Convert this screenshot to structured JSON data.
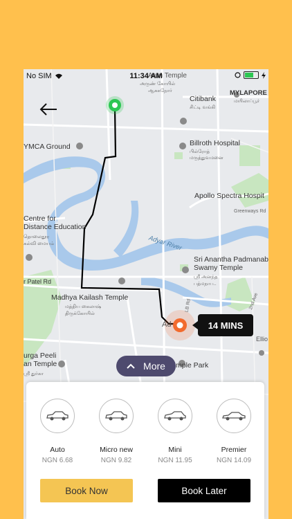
{
  "status_bar": {
    "carrier": "No SIM",
    "time": "11:34 AM"
  },
  "map_labels": {
    "temple_top": "Arun Temple",
    "temple_top_ta": "அருண் கோயில்",
    "temple_top_ta2": "ஆசுசுநோர்",
    "mylapore": "MYLAPORE",
    "mylapore_ta": "மயிலாப்பூர்",
    "citibank": "Citibank",
    "citibank_ta": "சிட்டி வங்கி",
    "billroth": "Billroth Hospital",
    "billroth_ta": "பில்ரோத்",
    "billroth_ta2": "மருத்துவமனை",
    "ymca": "YMCA Ground",
    "apollo": "Apollo Spectra Hospit",
    "greenways": "Greenways Rd",
    "centre_1": "Centre for",
    "centre_2": "Distance Education",
    "centre_ta1": "தொலைதூர",
    "centre_ta2": "கல்வி மையம்",
    "adyar_river": "Adyar River",
    "sri_ananta_1": "Sri Anantha Padmanab",
    "sri_ananta_2": "Swamy Temple",
    "sri_ananta_ta": "ஸ்ரீ அனந்த",
    "sri_ananta_ta2": "பத்மநாப..",
    "patel_rd": "r Patel Rd",
    "madhya_1": "Madhya Kailash Temple",
    "madhya_ta1": "மத்திய கைலாஷ்",
    "madhya_ta2": "திருக்கோயில்",
    "la_rd": "LB Rd",
    "ellio": "Ellio",
    "second_ave": "2nd Ave",
    "durga_1": "urga Peeli",
    "durga_2": "an Temple",
    "durga_ta": "ஸ்ரீ துர்கா",
    "temple_park": "mple Park",
    "adyar": "Ad"
  },
  "eta_badge": "14 MINS",
  "more_button": "More",
  "ride_options": [
    {
      "name": "Auto",
      "price": "NGN 6.68"
    },
    {
      "name": "Micro new",
      "price": "NGN 9.82"
    },
    {
      "name": "Mini",
      "price": "NGN 11.95"
    },
    {
      "name": "Premier",
      "price": "NGN 14.09"
    }
  ],
  "buttons": {
    "book_now": "Book Now",
    "book_later": "Book Later"
  },
  "colors": {
    "background": "#FFC04D",
    "accent": "#F4C553",
    "pickup": "#2DC653",
    "dropoff": "#F26B2E",
    "route": "#000000"
  }
}
